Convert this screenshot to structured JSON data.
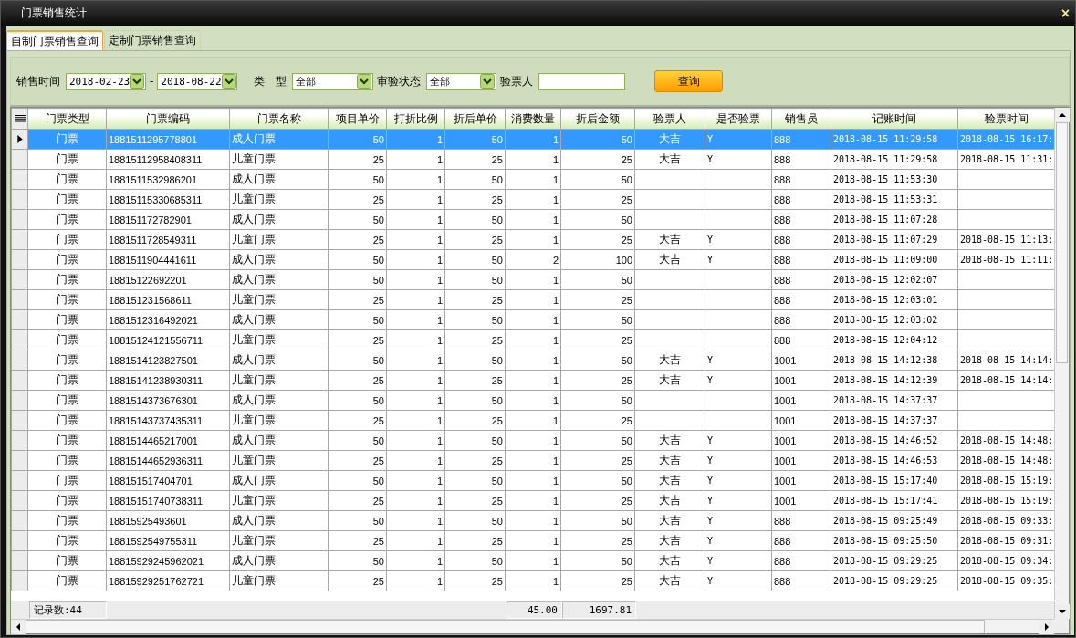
{
  "window": {
    "title": "门票销售统计",
    "close": "×"
  },
  "tabs": [
    {
      "label": "自制门票销售查询",
      "selected": true
    },
    {
      "label": "定制门票销售查询",
      "selected": false
    }
  ],
  "filters": {
    "sale_time_label": "销售时间",
    "date_from": "2018-02-23",
    "separator": "-",
    "date_to": "2018-08-22",
    "type_label": "类　型",
    "type_value": "全部",
    "audit_label": "审验状态",
    "audit_value": "全部",
    "inspector_label": "验票人",
    "query_button": "查询"
  },
  "table": {
    "columns": [
      "门票类型",
      "门票编码",
      "门票名称",
      "项目单价",
      "打折比例",
      "折后单价",
      "消费数量",
      "折后金额",
      "验票人",
      "是否验票",
      "销售员",
      "记账时间",
      "验票时间"
    ],
    "rows": [
      {
        "selected": true,
        "ticket_type": "门票",
        "code": "1881511295778801",
        "name": "成人门票",
        "unit_price": "50",
        "discount": "1",
        "discounted_price": "50",
        "quantity": "1",
        "amount": "50",
        "inspector": "大吉",
        "inspected": "Y",
        "seller": "888",
        "record_time": "2018-08-15 11:29:58",
        "inspect_time": "2018-08-15 16:17:"
      },
      {
        "selected": false,
        "ticket_type": "门票",
        "code": "18815112958408311",
        "name": "儿童门票",
        "unit_price": "25",
        "discount": "1",
        "discounted_price": "25",
        "quantity": "1",
        "amount": "25",
        "inspector": "大吉",
        "inspected": "Y",
        "seller": "888",
        "record_time": "2018-08-15 11:29:58",
        "inspect_time": "2018-08-15 11:31:"
      },
      {
        "selected": false,
        "ticket_type": "门票",
        "code": "1881511532986201",
        "name": "成人门票",
        "unit_price": "50",
        "discount": "1",
        "discounted_price": "50",
        "quantity": "1",
        "amount": "50",
        "seller": "888",
        "record_time": "2018-08-15 11:53:30"
      },
      {
        "selected": false,
        "ticket_type": "门票",
        "code": "18815115330685311",
        "name": "儿童门票",
        "unit_price": "25",
        "discount": "1",
        "discounted_price": "25",
        "quantity": "1",
        "amount": "25",
        "seller": "888",
        "record_time": "2018-08-15 11:53:31"
      },
      {
        "selected": false,
        "ticket_type": "门票",
        "code": "188151172782901",
        "name": "成人门票",
        "unit_price": "50",
        "discount": "1",
        "discounted_price": "50",
        "quantity": "1",
        "amount": "50",
        "seller": "888",
        "record_time": "2018-08-15 11:07:28"
      },
      {
        "selected": false,
        "ticket_type": "门票",
        "code": "1881511728549311",
        "name": "儿童门票",
        "unit_price": "25",
        "discount": "1",
        "discounted_price": "25",
        "quantity": "1",
        "amount": "25",
        "inspector": "大吉",
        "inspected": "Y",
        "seller": "888",
        "record_time": "2018-08-15 11:07:29",
        "inspect_time": "2018-08-15 11:13:"
      },
      {
        "selected": false,
        "ticket_type": "门票",
        "code": "1881511904441611",
        "name": "成人门票",
        "unit_price": "50",
        "discount": "1",
        "discounted_price": "50",
        "quantity": "2",
        "amount": "100",
        "inspector": "大吉",
        "inspected": "Y",
        "seller": "888",
        "record_time": "2018-08-15 11:09:00",
        "inspect_time": "2018-08-15 11:11:"
      },
      {
        "selected": false,
        "ticket_type": "门票",
        "code": "18815122692201",
        "name": "成人门票",
        "unit_price": "50",
        "discount": "1",
        "discounted_price": "50",
        "quantity": "1",
        "amount": "50",
        "seller": "888",
        "record_time": "2018-08-15 12:02:07"
      },
      {
        "selected": false,
        "ticket_type": "门票",
        "code": "188151231568611",
        "name": "儿童门票",
        "unit_price": "25",
        "discount": "1",
        "discounted_price": "25",
        "quantity": "1",
        "amount": "25",
        "seller": "888",
        "record_time": "2018-08-15 12:03:01"
      },
      {
        "selected": false,
        "ticket_type": "门票",
        "code": "1881512316492021",
        "name": "成人门票",
        "unit_price": "50",
        "discount": "1",
        "discounted_price": "50",
        "quantity": "1",
        "amount": "50",
        "seller": "888",
        "record_time": "2018-08-15 12:03:02"
      },
      {
        "selected": false,
        "ticket_type": "门票",
        "code": "18815124121556711",
        "name": "儿童门票",
        "unit_price": "25",
        "discount": "1",
        "discounted_price": "25",
        "quantity": "1",
        "amount": "25",
        "seller": "888",
        "record_time": "2018-08-15 12:04:12"
      },
      {
        "selected": false,
        "ticket_type": "门票",
        "code": "1881514123827501",
        "name": "成人门票",
        "unit_price": "50",
        "discount": "1",
        "discounted_price": "50",
        "quantity": "1",
        "amount": "50",
        "inspector": "大吉",
        "inspected": "Y",
        "seller": "1001",
        "record_time": "2018-08-15 14:12:38",
        "inspect_time": "2018-08-15 14:14:"
      },
      {
        "selected": false,
        "ticket_type": "门票",
        "code": "18815141238930311",
        "name": "儿童门票",
        "unit_price": "25",
        "discount": "1",
        "discounted_price": "25",
        "quantity": "1",
        "amount": "25",
        "inspector": "大吉",
        "inspected": "Y",
        "seller": "1001",
        "record_time": "2018-08-15 14:12:39",
        "inspect_time": "2018-08-15 14:14:"
      },
      {
        "selected": false,
        "ticket_type": "门票",
        "code": "1881514373676301",
        "name": "成人门票",
        "unit_price": "50",
        "discount": "1",
        "discounted_price": "50",
        "quantity": "1",
        "amount": "50",
        "seller": "1001",
        "record_time": "2018-08-15 14:37:37"
      },
      {
        "selected": false,
        "ticket_type": "门票",
        "code": "18815143737435311",
        "name": "儿童门票",
        "unit_price": "25",
        "discount": "1",
        "discounted_price": "25",
        "quantity": "1",
        "amount": "25",
        "seller": "1001",
        "record_time": "2018-08-15 14:37:37"
      },
      {
        "selected": false,
        "ticket_type": "门票",
        "code": "1881514465217001",
        "name": "成人门票",
        "unit_price": "50",
        "discount": "1",
        "discounted_price": "50",
        "quantity": "1",
        "amount": "50",
        "inspector": "大吉",
        "inspected": "Y",
        "seller": "1001",
        "record_time": "2018-08-15 14:46:52",
        "inspect_time": "2018-08-15 14:48:"
      },
      {
        "selected": false,
        "ticket_type": "门票",
        "code": "18815144652936311",
        "name": "儿童门票",
        "unit_price": "25",
        "discount": "1",
        "discounted_price": "25",
        "quantity": "1",
        "amount": "25",
        "inspector": "大吉",
        "inspected": "Y",
        "seller": "1001",
        "record_time": "2018-08-15 14:46:53",
        "inspect_time": "2018-08-15 14:48:"
      },
      {
        "selected": false,
        "ticket_type": "门票",
        "code": "188151517404701",
        "name": "成人门票",
        "unit_price": "50",
        "discount": "1",
        "discounted_price": "50",
        "quantity": "1",
        "amount": "50",
        "inspector": "大吉",
        "inspected": "Y",
        "seller": "1001",
        "record_time": "2018-08-15 15:17:40",
        "inspect_time": "2018-08-15 15:19:"
      },
      {
        "selected": false,
        "ticket_type": "门票",
        "code": "18815151740738311",
        "name": "儿童门票",
        "unit_price": "25",
        "discount": "1",
        "discounted_price": "25",
        "quantity": "1",
        "amount": "25",
        "inspector": "大吉",
        "inspected": "Y",
        "seller": "1001",
        "record_time": "2018-08-15 15:17:41",
        "inspect_time": "2018-08-15 15:19:"
      },
      {
        "selected": false,
        "ticket_type": "门票",
        "code": "18815925493601",
        "name": "成人门票",
        "unit_price": "50",
        "discount": "1",
        "discounted_price": "50",
        "quantity": "1",
        "amount": "50",
        "inspector": "大吉",
        "inspected": "Y",
        "seller": "888",
        "record_time": "2018-08-15 09:25:49",
        "inspect_time": "2018-08-15 09:33:"
      },
      {
        "selected": false,
        "ticket_type": "门票",
        "code": "1881592549755311",
        "name": "儿童门票",
        "unit_price": "25",
        "discount": "1",
        "discounted_price": "25",
        "quantity": "1",
        "amount": "25",
        "inspector": "大吉",
        "inspected": "Y",
        "seller": "888",
        "record_time": "2018-08-15 09:25:50",
        "inspect_time": "2018-08-15 09:31:"
      },
      {
        "selected": false,
        "ticket_type": "门票",
        "code": "18815929245962021",
        "name": "成人门票",
        "unit_price": "50",
        "discount": "1",
        "discounted_price": "50",
        "quantity": "1",
        "amount": "50",
        "inspector": "大吉",
        "inspected": "Y",
        "seller": "888",
        "record_time": "2018-08-15 09:29:25",
        "inspect_time": "2018-08-15 09:34:"
      },
      {
        "selected": false,
        "ticket_type": "门票",
        "code": "18815929251762721",
        "name": "儿童门票",
        "unit_price": "25",
        "discount": "1",
        "discounted_price": "25",
        "quantity": "1",
        "amount": "25",
        "inspector": "大吉",
        "inspected": "Y",
        "seller": "888",
        "record_time": "2018-08-15 09:29:25",
        "inspect_time": "2018-08-15 09:35:"
      }
    ],
    "footer": {
      "record_count": "记录数:44",
      "quantity_total": "45.00",
      "amount_total": "1697.81"
    }
  }
}
